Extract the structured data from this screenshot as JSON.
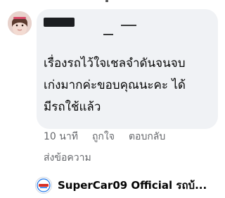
{
  "comment": {
    "lines": [
      "เรื่องรถไว้ใจเชลจำดันจนจบ",
      "เก่งมากค่ะขอบคุณนะคะ ได้",
      "มีรถใช้แล้ว"
    ]
  },
  "actions": {
    "time": "10 นาที",
    "like": "ถูกใจ",
    "reply": "ตอบกลับ",
    "message": "ส่งข้อความ"
  },
  "page_reply": {
    "name": "SuperCar09 Official รถบ้...",
    "logo_icon": "supercar-logo-icon"
  },
  "colors": {
    "bubble": "#f0f2f5",
    "text": "#050505",
    "meta": "#65676b",
    "logo_accent": "#1a73e8"
  }
}
